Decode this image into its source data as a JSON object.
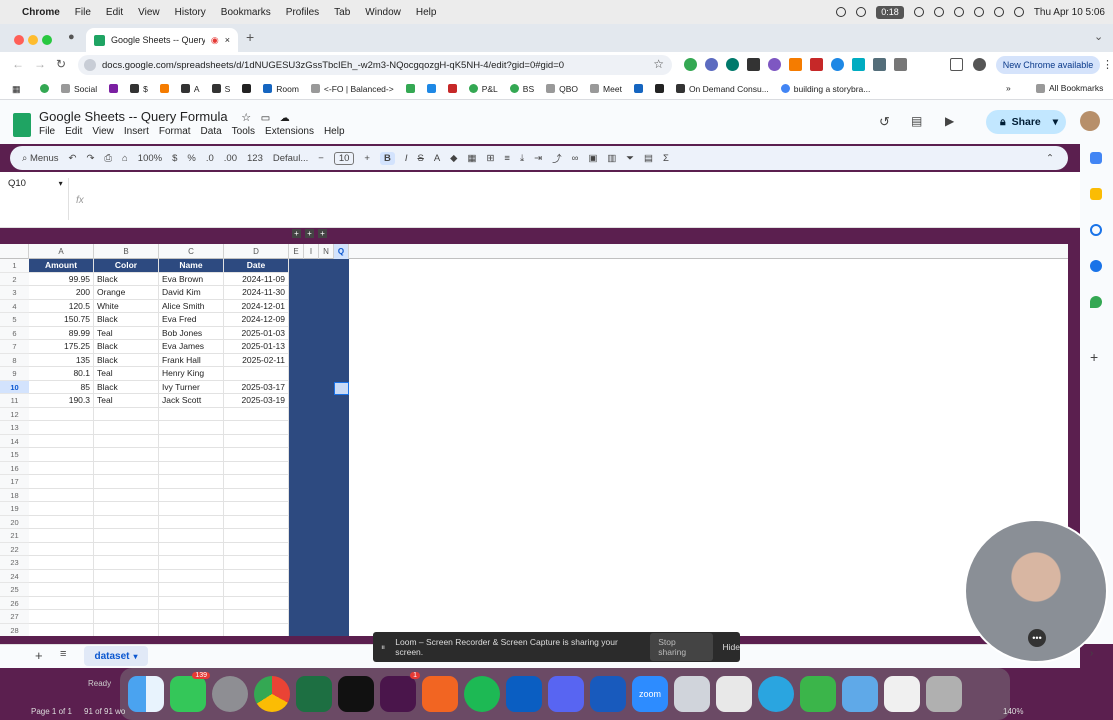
{
  "menubar": {
    "app": "Chrome",
    "items": [
      "File",
      "Edit",
      "View",
      "History",
      "Bookmarks",
      "Profiles",
      "Tab",
      "Window",
      "Help"
    ],
    "recording_time": "0:18",
    "clock": "Thu Apr 10  5:06"
  },
  "browser": {
    "tab_title": "Google Sheets -- Query I",
    "url": "docs.google.com/spreadsheets/d/1dNUGESU3zGssTbcIEh_-w2m3-NQocgqozgH-qK5NH-4/edit?gid=0#gid=0",
    "new_chrome": "New Chrome available",
    "bookmarks": [
      "Social",
      "$",
      "A",
      "S",
      "Room",
      "<-FO | Balanced->",
      "P&L",
      "BS",
      "QBO",
      "Meet",
      "On Demand Consu...",
      "building a storybra..."
    ],
    "all_bookmarks": "All Bookmarks"
  },
  "sheets": {
    "title": "Google Sheets -- Query Formula",
    "menu": [
      "File",
      "Edit",
      "View",
      "Insert",
      "Format",
      "Data",
      "Tools",
      "Extensions",
      "Help"
    ],
    "share": "Share",
    "toolbar": {
      "menus": "Menus",
      "zoom": "100%",
      "currency": "$",
      "percent": "%",
      "dec_dec": ".0",
      "inc_dec": ".00",
      "format_123": "123",
      "font": "Defaul...",
      "font_size": "10",
      "bold": "B",
      "italic": "I",
      "strike": "S",
      "text_color": "A",
      "sum": "Σ"
    },
    "namebox": "Q10",
    "fx": "fx",
    "columns": [
      "A",
      "B",
      "C",
      "D",
      "E",
      "I",
      "N",
      "Q"
    ],
    "headers": [
      "Amount",
      "Color",
      "Name",
      "Date"
    ],
    "rows": [
      [
        "99.95",
        "Black",
        "Eva Brown",
        "2024-11-09"
      ],
      [
        "200",
        "Orange",
        "David Kim",
        "2024-11-30"
      ],
      [
        "120.5",
        "White",
        "Alice Smith",
        "2024-12-01"
      ],
      [
        "150.75",
        "Black",
        "Eva Fred",
        "2024-12-09"
      ],
      [
        "89.99",
        "Teal",
        "Bob Jones",
        "2025-01-03"
      ],
      [
        "175.25",
        "Black",
        "Eva James",
        "2025-01-13"
      ],
      [
        "135",
        "Black",
        "Frank Hall",
        "2025-02-11"
      ],
      [
        "80.1",
        "Teal",
        "Henry King",
        ""
      ],
      [
        "85",
        "Black",
        "Ivy Turner",
        "2025-03-17"
      ],
      [
        "190.3",
        "Teal",
        "Jack Scott",
        "2025-03-19"
      ]
    ],
    "row_numbers": [
      "1",
      "2",
      "3",
      "4",
      "5",
      "6",
      "7",
      "8",
      "9",
      "10",
      "11",
      "12",
      "13",
      "14",
      "15",
      "16",
      "17",
      "18",
      "19",
      "20",
      "21",
      "22",
      "23",
      "24",
      "25",
      "26",
      "27",
      "28"
    ],
    "sheet_tab": "dataset"
  },
  "loom": {
    "message": "Loom – Screen Recorder & Screen Capture is sharing your screen.",
    "stop": "Stop sharing",
    "hide": "Hide"
  },
  "dock": {
    "messages_badge": "139",
    "slack_badge": "1",
    "zoom_label": "zoom"
  },
  "statusbar": {
    "ready": "Ready",
    "page": "Page 1 of 1",
    "words": "91 of 91 wo",
    "zoom": "140%"
  }
}
